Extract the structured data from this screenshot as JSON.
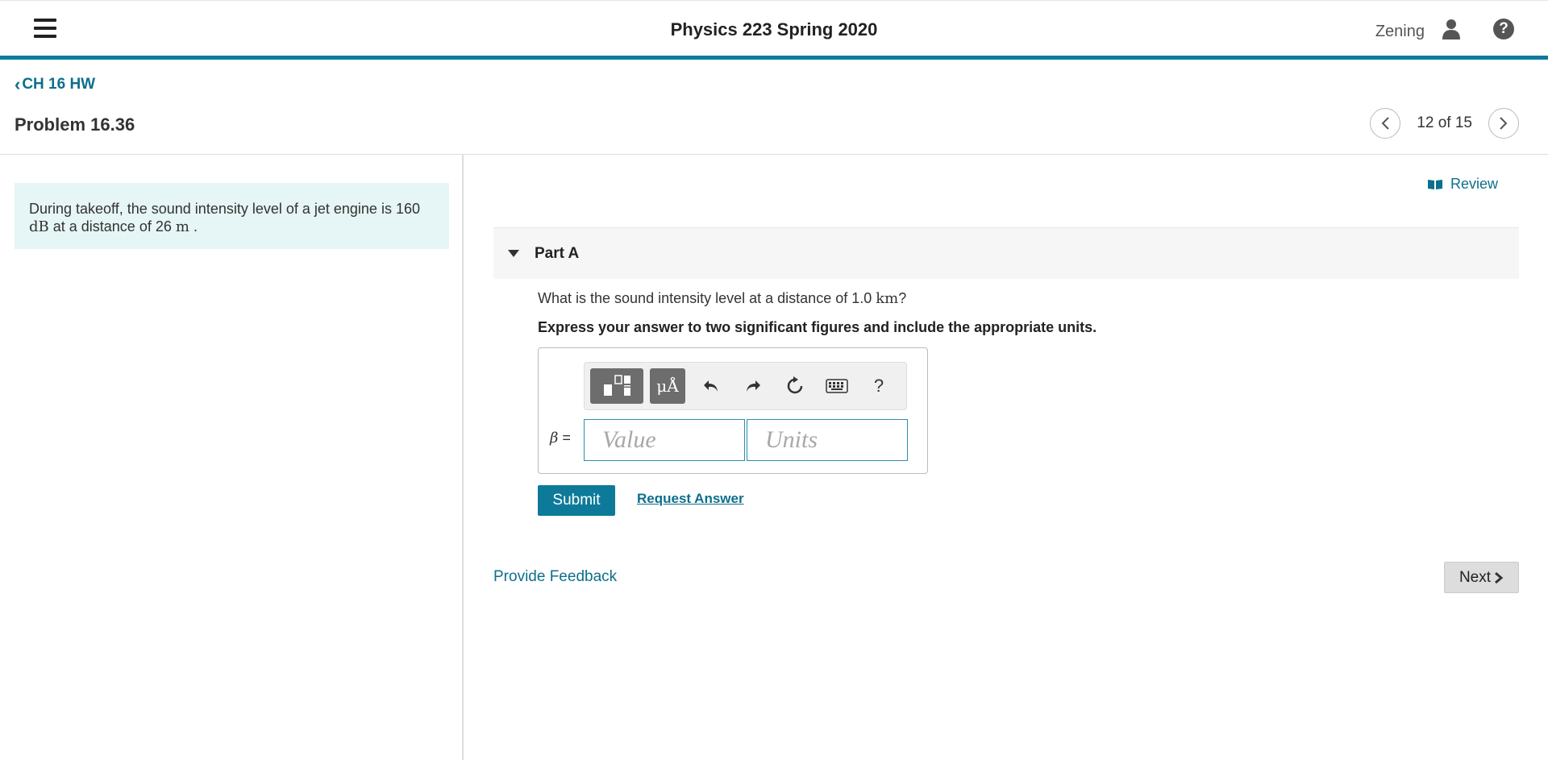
{
  "header": {
    "course_title": "Physics 223 Spring 2020",
    "user_name": "Zening",
    "help_symbol": "?"
  },
  "nav": {
    "back_label": "CH 16 HW",
    "problem_title": "Problem 16.36",
    "pager": {
      "current": 12,
      "total": 15,
      "label": "12 of 15"
    }
  },
  "intro": {
    "text_1": "During takeoff, the sound intensity level of a jet engine is 160 ",
    "unit_1": "dB",
    "text_2": " at a distance of 26 ",
    "unit_2": "m",
    "text_3": " ."
  },
  "review": {
    "label": "Review"
  },
  "part": {
    "label": "Part A",
    "question_text": "What is the sound intensity level at a distance of 1.0 ",
    "question_unit": "km",
    "question_end": "?",
    "instruction": "Express your answer to two significant figures and include the appropriate units."
  },
  "answer": {
    "variable": "β",
    "equals": " =",
    "value_placeholder": "Value",
    "units_placeholder": "Units",
    "toolbar": {
      "templates_icon": "templates-icon",
      "units_symbol": "μÅ",
      "undo_icon": "undo-icon",
      "redo_icon": "redo-icon",
      "reset_icon": "reset-icon",
      "keyboard_icon": "keyboard-icon",
      "help_symbol": "?"
    }
  },
  "actions": {
    "submit_label": "Submit",
    "request_answer_label": "Request Answer",
    "feedback_label": "Provide Feedback",
    "next_label": "Next"
  },
  "colors": {
    "accent": "#0d7a9a",
    "link": "#0d6f8c",
    "intro_bg": "#e6f5f5"
  }
}
